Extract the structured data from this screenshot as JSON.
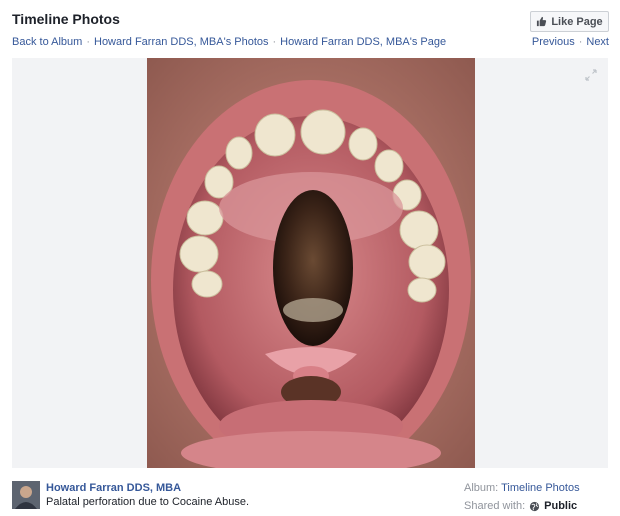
{
  "header": {
    "title": "Timeline Photos",
    "like_button": "Like Page"
  },
  "breadcrumbs": {
    "back": "Back to Album",
    "photos": "Howard Farran DDS, MBA's Photos",
    "page": "Howard Farran DDS, MBA's Page",
    "separator": "·"
  },
  "nav": {
    "previous": "Previous",
    "next": "Next"
  },
  "photo": {
    "subject": "open mouth showing palatal perforation"
  },
  "footer": {
    "author": "Howard Farran DDS, MBA",
    "caption": "Palatal perforation due to Cocaine Abuse.",
    "album_label": "Album:",
    "album_name": "Timeline Photos",
    "shared_label": "Shared with:",
    "shared_value": "Public"
  },
  "icons": {
    "like": "thumbs-up-icon",
    "expand": "expand-icon",
    "globe": "globe-icon"
  },
  "colors": {
    "link": "#365899",
    "text": "#1d2129",
    "muted": "#90949c",
    "stage_bg": "#f2f3f5"
  }
}
